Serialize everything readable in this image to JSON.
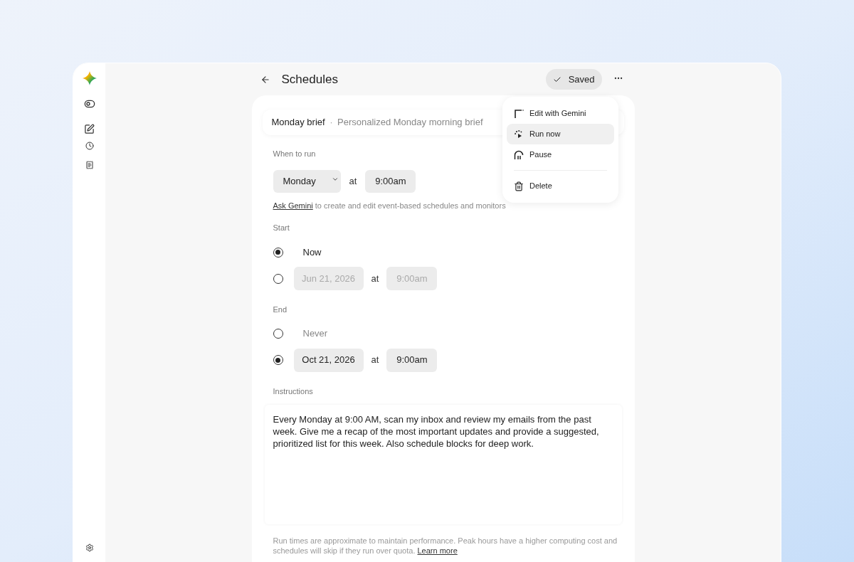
{
  "header": {
    "title": "Schedules",
    "saved_label": "Saved"
  },
  "menu": {
    "items": [
      {
        "kind": "edit",
        "label": "Edit with Gemini",
        "selected": false
      },
      {
        "kind": "run",
        "label": "Run now",
        "selected": true
      },
      {
        "kind": "pause",
        "label": "Pause",
        "selected": false
      },
      {
        "kind": "delete",
        "label": "Delete",
        "selected": false
      }
    ]
  },
  "schedule": {
    "name": "Monday brief",
    "separator": "·",
    "description": "Personalized Monday morning brief"
  },
  "when_to_run": {
    "label": "When to run",
    "day": "Monday",
    "at": "at",
    "time": "9:00am"
  },
  "ask_gemini": {
    "link": "Ask Gemini",
    "text": "to create and edit event-based schedules and monitors"
  },
  "start": {
    "label": "Start",
    "options": [
      {
        "kind": "text",
        "label": "Now",
        "selected": true
      },
      {
        "kind": "datetime",
        "date": "Jun 21, 2026",
        "at": "at",
        "time": "9:00am",
        "selected": false
      }
    ]
  },
  "end": {
    "label": "End",
    "options": [
      {
        "kind": "text",
        "label": "Never",
        "selected": false
      },
      {
        "kind": "datetime",
        "date": "Oct 21, 2026",
        "at": "at",
        "time": "9:00am",
        "selected": true
      }
    ]
  },
  "instructions": {
    "label": "Instructions",
    "value": "Every Monday at 9:00 AM, scan my inbox and review my emails from the past week. Give me a recap of the most important updates and provide a suggested, prioritized list for this week. Also schedule blocks for deep work."
  },
  "footnote": {
    "text": "Run times are approximate to maintain performance. Peak hours have a higher computing cost and schedules will skip if they run over quota.",
    "link": "Learn more"
  }
}
